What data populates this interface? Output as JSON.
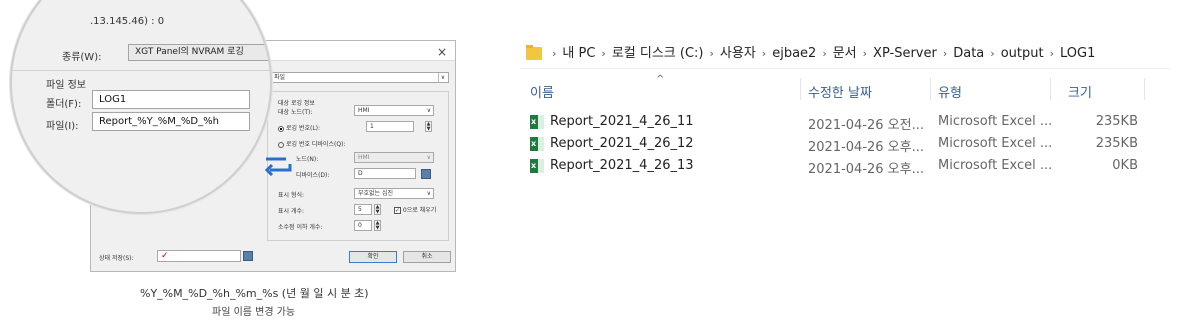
{
  "dialog": {
    "format_value": "CSV 파일",
    "group_title": "대상 로깅 정보",
    "target_node_label": "대상 노드(T):",
    "target_node_value": "HMI",
    "log_number_label": "로깅 번호(L):",
    "log_number_value": "1",
    "log_device_label": "로깅 번호 디바이스(Q):",
    "node_label": "노드(N):",
    "node_value": "HMI",
    "device_label": "디바이스(D):",
    "device_value": "D",
    "display_format_label": "표시 형식:",
    "display_format_value": "부호없는 십진",
    "display_count_label": "표시 개수:",
    "display_count_value": "5",
    "zero_fill_label": "0으로 채우기",
    "decimal_count_label": "소수점 이하 개수:",
    "decimal_count_value": "0",
    "state_save_label": "상태 저장(S):",
    "state_save_value": "✓",
    "ok_label": "확인",
    "cancel_label": "취소",
    "close_glyph": "×"
  },
  "magnifier": {
    "ip_text": ".13.145.46) : 0",
    "type_label": "종류(W):",
    "type_value": "XGT Panel의 NVRAM 로깅",
    "file_info_label": "파일 정보",
    "folder_label": "폴더(F):",
    "folder_value": "LOG1",
    "filename_label": "파일(I):",
    "filename_value": "Report_%Y_%M_%D_%h"
  },
  "caption": {
    "line1": "%Y_%M_%D_%h_%m_%s (년 월 일 시 분 초)",
    "line2": "파일 이름 변경 가능"
  },
  "explorer": {
    "breadcrumb": [
      "내 PC",
      "로컬 디스크 (C:)",
      "사용자",
      "ejbae2",
      "문서",
      "XP-Server",
      "Data",
      "output",
      "LOG1"
    ],
    "headers": {
      "name": "이름",
      "date": "수정한 날짜",
      "type": "유형",
      "size": "크기"
    },
    "files": [
      {
        "name": "Report_2021_4_26_11",
        "date": "2021-04-26 오전...",
        "type": "Microsoft Excel ...",
        "size": "235KB"
      },
      {
        "name": "Report_2021_4_26_12",
        "date": "2021-04-26 오후...",
        "type": "Microsoft Excel ...",
        "size": "235KB"
      },
      {
        "name": "Report_2021_4_26_13",
        "date": "2021-04-26 오후...",
        "type": "Microsoft Excel ...",
        "size": "0KB"
      }
    ]
  },
  "colors": {
    "accent": "#3b5e8f",
    "excel": "#1f7a3f",
    "folder": "#f3c641",
    "check": "#d00000"
  }
}
